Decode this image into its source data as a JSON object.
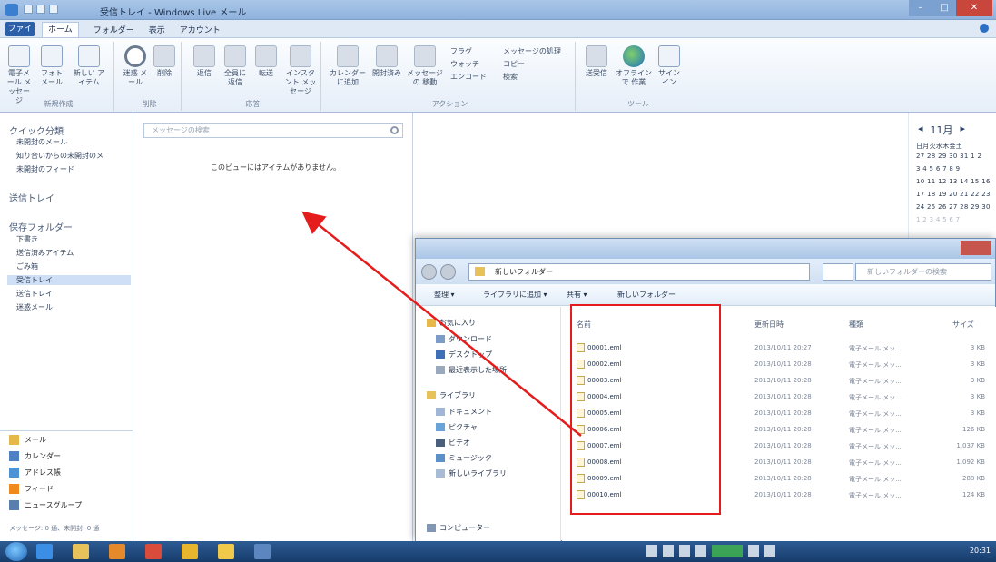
{
  "window": {
    "title": "受信トレイ - Windows Live メール"
  },
  "ribbon_tabs": {
    "file": "ファイル",
    "tabs": [
      "ホーム",
      "フォルダー",
      "表示",
      "アカウント"
    ]
  },
  "ribbon": {
    "new_group": {
      "label": "新規作成",
      "buttons": [
        "電子メール メッセージ",
        "フォト メール",
        "新しい アイテム"
      ]
    },
    "delete_group": {
      "label": "削除",
      "buttons": [
        "迷惑 メール",
        "削除"
      ]
    },
    "reply_group": {
      "label": "応答",
      "buttons": [
        "返信",
        "全員に 返信",
        "転送",
        "インスタント メッセージ"
      ]
    },
    "actions_group": {
      "label": "アクション",
      "buttons": [
        "カレンダーに追加",
        "開封済み",
        "メッセージの 移動",
        "フラグ",
        "ウォッチ",
        "エンコード",
        "メッセージの処理",
        "コピー",
        "検索"
      ]
    },
    "tools_group": {
      "label": "ツール",
      "buttons": [
        "送受信",
        "オフラインで 作業",
        "サインイン"
      ]
    }
  },
  "folders": {
    "quick_views_head": "クイック分類",
    "quick_views": [
      "未開封のメール",
      "知り合いからの未開封のメ",
      "未開封のフィード"
    ],
    "outbox": "送信トレイ",
    "storage_head": "保存フォルダー",
    "storage_items": [
      "下書き",
      "送信済みアイテム",
      "ごみ箱",
      "受信トレイ",
      "送信トレイ",
      "迷惑メール"
    ],
    "selected": "受信トレイ"
  },
  "nav_bottom": [
    {
      "label": "メール",
      "icon": "mail-icon",
      "color": "#e6b84a"
    },
    {
      "label": "カレンダー",
      "icon": "calendar-icon",
      "color": "#4f7fc4"
    },
    {
      "label": "アドレス帳",
      "icon": "contacts-icon",
      "color": "#4b92d6"
    },
    {
      "label": "フィード",
      "icon": "feed-icon",
      "color": "#f08a1e"
    },
    {
      "label": "ニュースグループ",
      "icon": "newsgroup-icon",
      "color": "#5a7fae"
    }
  ],
  "status": "メッセージ: 0 通、未開封: 0 通",
  "message_list": {
    "search_placeholder": "メッセージの検索",
    "empty_text": "このビューにはアイテムがありません。"
  },
  "calendar": {
    "month": "11月",
    "rows": [
      {
        "text": "日月火水木金土",
        "dim": false
      },
      {
        "text": "27 28 29 30 31 1 2",
        "dim": false
      },
      {
        "text": "3 4 5 6 7 8 9",
        "dim": false
      },
      {
        "text": "10 11 12 13 14 15 16",
        "dim": false
      },
      {
        "text": "17 18 19 20 21 22 23",
        "dim": false
      },
      {
        "text": "24 25 26 27 28 29 30",
        "dim": false
      },
      {
        "text": "1 2 3 4 5 6 7",
        "dim": true
      }
    ]
  },
  "explorer": {
    "address": "新しいフォルダー",
    "search_placeholder": "新しいフォルダーの検索",
    "commands": [
      "整理 ▾",
      "ライブラリに追加 ▾",
      "共有 ▾",
      "新しいフォルダー"
    ],
    "tree": [
      {
        "label": "お気に入り",
        "icon": "favorites-icon",
        "color": "#e8b84a",
        "indent": 0
      },
      {
        "label": "ダウンロード",
        "icon": "download-icon",
        "color": "#7c9bc7",
        "indent": 1
      },
      {
        "label": "デスクトップ",
        "icon": "desktop-icon",
        "color": "#3f6fb6",
        "indent": 1
      },
      {
        "label": "最近表示した場所",
        "icon": "recent-icon",
        "color": "#9aa9bd",
        "indent": 1
      },
      {
        "label": "ライブラリ",
        "icon": "library-icon",
        "color": "#e7c25a",
        "indent": 0
      },
      {
        "label": "ドキュメント",
        "icon": "documents-icon",
        "color": "#9fb6d6",
        "indent": 1
      },
      {
        "label": "ピクチャ",
        "icon": "pictures-icon",
        "color": "#6aa3d8",
        "indent": 1
      },
      {
        "label": "ビデオ",
        "icon": "videos-icon",
        "color": "#4a5f7c",
        "indent": 1
      },
      {
        "label": "ミュージック",
        "icon": "music-icon",
        "color": "#5d8fc9",
        "indent": 1
      },
      {
        "label": "新しいライブラリ",
        "icon": "new-library-icon",
        "color": "#a9bcd6",
        "indent": 1
      },
      {
        "label": "コンピューター",
        "icon": "computer-icon",
        "color": "#8096b3",
        "indent": 0
      }
    ],
    "columns": {
      "name": "名前",
      "date": "更新日時",
      "type": "種類",
      "size": "サイズ"
    },
    "files": [
      {
        "name": "00001.eml",
        "date": "2013/10/11 20:27",
        "type": "電子メール メッ...",
        "size": "3 KB"
      },
      {
        "name": "00002.eml",
        "date": "2013/10/11 20:28",
        "type": "電子メール メッ...",
        "size": "3 KB"
      },
      {
        "name": "00003.eml",
        "date": "2013/10/11 20:28",
        "type": "電子メール メッ...",
        "size": "3 KB"
      },
      {
        "name": "00004.eml",
        "date": "2013/10/11 20:28",
        "type": "電子メール メッ...",
        "size": "3 KB"
      },
      {
        "name": "00005.eml",
        "date": "2013/10/11 20:28",
        "type": "電子メール メッ...",
        "size": "3 KB"
      },
      {
        "name": "00006.eml",
        "date": "2013/10/11 20:28",
        "type": "電子メール メッ...",
        "size": "126 KB"
      },
      {
        "name": "00007.eml",
        "date": "2013/10/11 20:28",
        "type": "電子メール メッ...",
        "size": "1,037 KB"
      },
      {
        "name": "00008.eml",
        "date": "2013/10/11 20:28",
        "type": "電子メール メッ...",
        "size": "1,092 KB"
      },
      {
        "name": "00009.eml",
        "date": "2013/10/11 20:28",
        "type": "電子メール メッ...",
        "size": "288 KB"
      },
      {
        "name": "00010.eml",
        "date": "2013/10/11 20:28",
        "type": "電子メール メッ...",
        "size": "124 KB"
      }
    ]
  },
  "annotation": {
    "color": "#e51c1c"
  },
  "taskbar": {
    "apps": [
      {
        "icon": "ie-icon",
        "color": "#3a8ee6"
      },
      {
        "icon": "explorer-icon",
        "color": "#e7c25a"
      },
      {
        "icon": "media-player-icon",
        "color": "#e58a2a"
      },
      {
        "icon": "mail-app-icon",
        "color": "#d94b3a"
      },
      {
        "icon": "chrome-icon",
        "color": "#e8b62e"
      },
      {
        "icon": "folder-icon",
        "color": "#f0c94a"
      },
      {
        "icon": "windows-live-mail-icon",
        "color": "#5c86bf"
      }
    ],
    "time": "20:31"
  }
}
